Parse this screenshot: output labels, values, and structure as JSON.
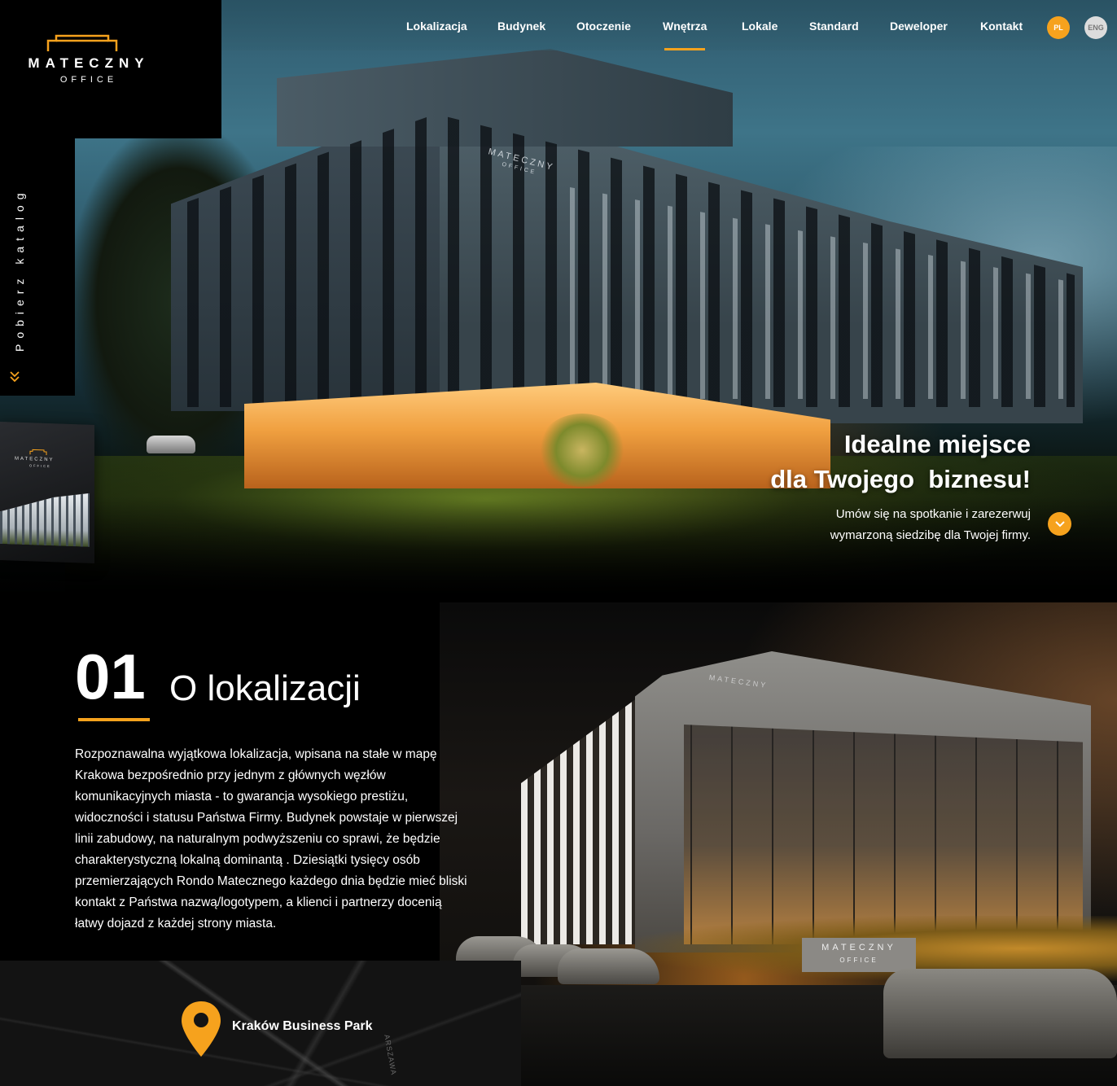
{
  "brand": {
    "name": "MATECZNY",
    "sub": "OFFICE",
    "accent_color": "#f6a21d"
  },
  "nav": {
    "items": [
      {
        "label": "Lokalizacja"
      },
      {
        "label": "Budynek"
      },
      {
        "label": "Otoczenie"
      },
      {
        "label": "Wnętrza",
        "active": true
      },
      {
        "label": "Lokale"
      },
      {
        "label": "Standard"
      },
      {
        "label": "Deweloper"
      },
      {
        "label": "Kontakt"
      }
    ],
    "languages": [
      {
        "label": "PL",
        "active": true
      },
      {
        "label": "ENG",
        "active": false
      }
    ]
  },
  "sidebar": {
    "catalog_label": "Pobierz katalog",
    "icon": "chevrons-down-icon",
    "thumb_title": "MATECZNY",
    "thumb_sub": "OFFICE"
  },
  "hero": {
    "title_line1": "Idealne miejsce",
    "title_line2": "dla Twojego  biznesu!",
    "subtitle_line1": "Umów się na spotkanie i zarezerwuj",
    "subtitle_line2": "wymarzoną siedzibę dla Twojej firmy.",
    "building_sign": "MATECZNY",
    "building_sign_sub": "OFFICE",
    "scroll_icon": "chevron-down-icon"
  },
  "section1": {
    "number": "01",
    "title": "O lokalizacji",
    "body": "Rozpoznawalna wyjątkowa lokalizacja, wpisana na stałe w mapę Krakowa  bezpośrednio przy jednym z głównych węzłów komunikacyjnych miasta - to gwarancja wysokiego prestiżu, widoczności i statusu Państwa Firmy. Budynek powstaje w pierwszej linii zabudowy, na naturalnym podwyższeniu co sprawi, że będzie charakterystyczną lokalną dominantą . Dziesiątki tysięcy osób przemierzających Rondo Matecznego każdego dnia będzie mieć bliski kontakt z Państwa nazwą/logotypem, a klienci i partnerzy docenią łatwy dojazd z każdej strony miasta.",
    "render_sign": "MATECZNY",
    "render_sign_sub": "OFFICE",
    "map_label": "Kraków Business Park",
    "map_street": "ARSZAWA",
    "map_icon": "map-pin-icon"
  }
}
